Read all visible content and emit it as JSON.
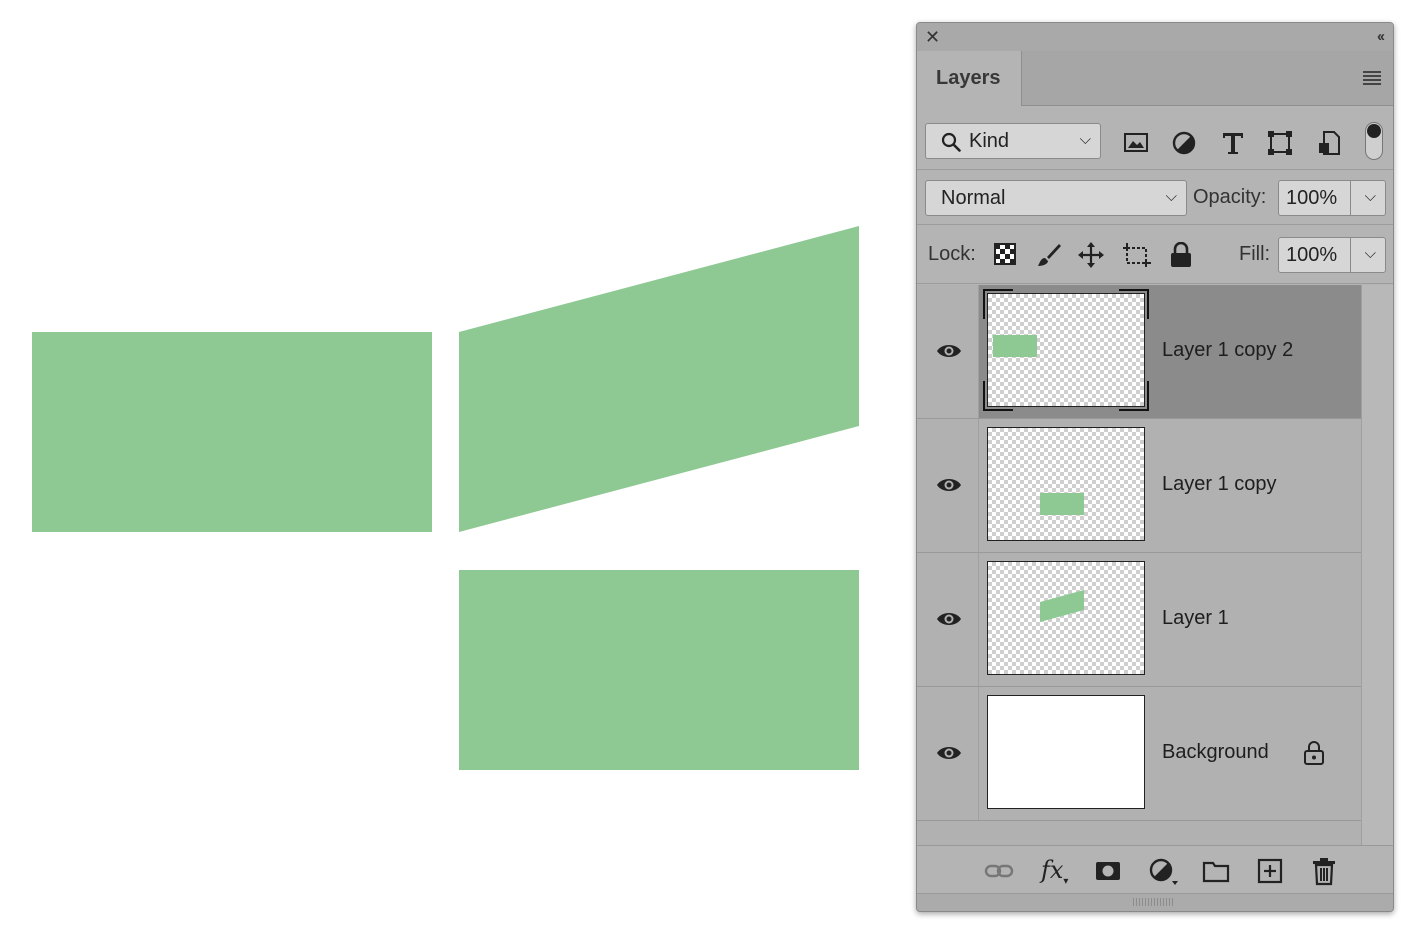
{
  "canvas": {
    "shape_color": "#8ec994",
    "background_color": "#ffffff"
  },
  "panel": {
    "tab_label": "Layers",
    "close_icon": "close-icon",
    "collapse_icon": "collapse-icon",
    "menu_icon": "panel-menu-icon",
    "filter": {
      "kind_label": "Kind",
      "icons": [
        "pixel-layer-filter-icon",
        "adjustment-layer-filter-icon",
        "type-layer-filter-icon",
        "shape-layer-filter-icon",
        "smart-object-filter-icon"
      ]
    },
    "blend": {
      "mode": "Normal",
      "opacity_label": "Opacity:",
      "opacity_value": "100%"
    },
    "lock": {
      "label": "Lock:",
      "icons": [
        "lock-transparent-icon",
        "lock-image-icon",
        "lock-position-icon",
        "lock-artboard-icon",
        "lock-all-icon"
      ],
      "fill_label": "Fill:",
      "fill_value": "100%"
    },
    "layers": [
      {
        "name": "Layer 1 copy 2",
        "visible": true,
        "selected": true
      },
      {
        "name": "Layer 1 copy",
        "visible": true,
        "selected": false
      },
      {
        "name": "Layer 1",
        "visible": true,
        "selected": false
      },
      {
        "name": "Background",
        "visible": true,
        "selected": false,
        "locked": true
      }
    ],
    "bottom_icons": [
      "link-layers-icon",
      "fx-icon",
      "add-mask-icon",
      "new-adjustment-icon",
      "new-group-icon",
      "new-layer-icon",
      "delete-layer-icon"
    ],
    "fx_label": "fx"
  }
}
